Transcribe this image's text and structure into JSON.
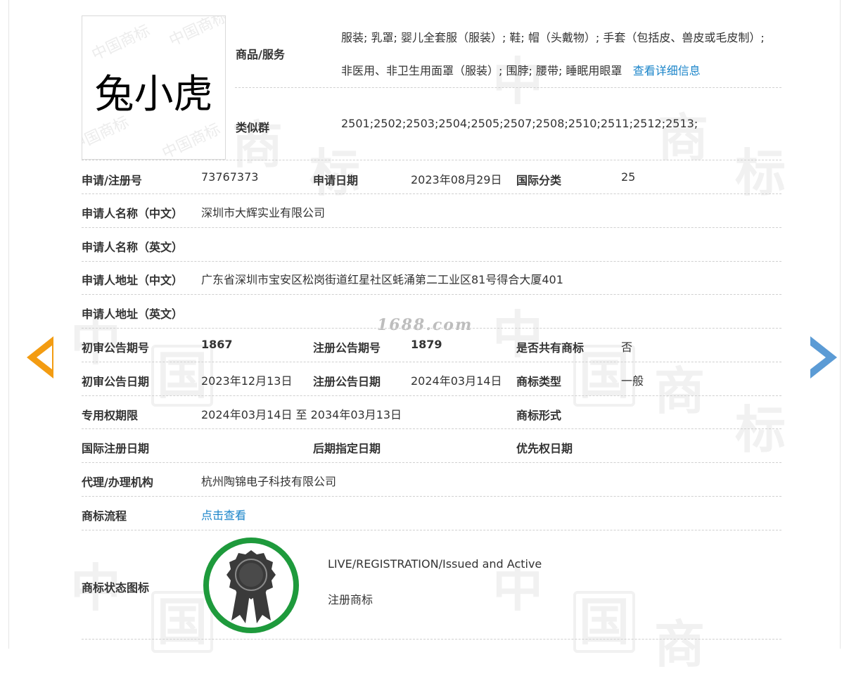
{
  "logo": {
    "text": "兔小虎"
  },
  "goods": {
    "label": "商品/服务",
    "line1": "服装; 乳罩; 婴儿全套服（服装）; 鞋; 帽（头戴物）; 手套（包括皮、兽皮或毛皮制）;",
    "line2": "非医用、非卫生用面罩（服装）; 围脖; 腰带; 睡眠用眼罩",
    "detail_link": "查看详细信息"
  },
  "similar_group": {
    "label": "类似群",
    "value": "2501;2502;2503;2504;2505;2507;2508;2510;2511;2512;2513;"
  },
  "row_reg": {
    "reg_no_label": "申请/注册号",
    "reg_no": "73767373",
    "apply_date_label": "申请日期",
    "apply_date": "2023年08月29日",
    "intl_class_label": "国际分类",
    "intl_class": "25"
  },
  "applicant_cn": {
    "label": "申请人名称（中文）",
    "value": "深圳市大辉实业有限公司"
  },
  "applicant_en": {
    "label": "申请人名称（英文）",
    "value": ""
  },
  "address_cn": {
    "label": "申请人地址（中文）",
    "value": "广东省深圳市宝安区松岗街道红星社区蚝涌第二工业区81号得合大厦401"
  },
  "address_en": {
    "label": "申请人地址（英文）",
    "value": ""
  },
  "row_gazette_no": {
    "prelim_no_label": "初审公告期号",
    "prelim_no": "1867",
    "reg_no_label": "注册公告期号",
    "reg_no": "1879",
    "shared_label": "是否共有商标",
    "shared": "否"
  },
  "row_gazette_date": {
    "prelim_date_label": "初审公告日期",
    "prelim_date": "2023年12月13日",
    "reg_date_label": "注册公告日期",
    "reg_date": "2024年03月14日",
    "type_label": "商标类型",
    "type": "一般"
  },
  "row_exclusive": {
    "period_label": "专用权期限",
    "period": "2024年03月14日 至 2034年03月13日",
    "form_label": "商标形式",
    "form": ""
  },
  "row_intl": {
    "intl_reg_label": "国际注册日期",
    "intl_reg": "",
    "later_label": "后期指定日期",
    "later": "",
    "priority_label": "优先权日期",
    "priority": ""
  },
  "agent": {
    "label": "代理/办理机构",
    "value": "杭州陶锦电子科技有限公司"
  },
  "flow": {
    "label": "商标流程",
    "link": "点击查看"
  },
  "status": {
    "label": "商标状态图标",
    "en": "LIVE/REGISTRATION/Issued and Active",
    "cn": "注册商标",
    "ring_color": "#1e9a3c",
    "icon_color": "#3a3a3a"
  },
  "site_watermark": "1688.com",
  "colors": {
    "link": "#1a84c9",
    "prev_arrow": "#f39c12",
    "next_arrow": "#5b9bd5"
  }
}
